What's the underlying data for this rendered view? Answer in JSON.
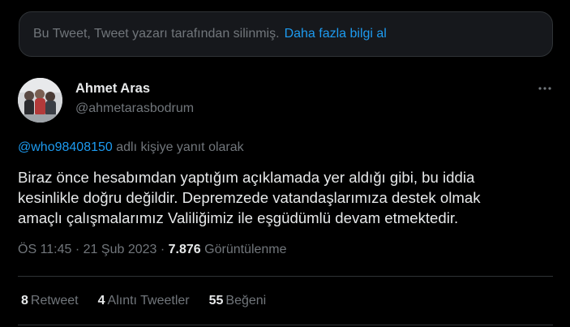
{
  "deleted_notice": {
    "text": "Bu Tweet, Tweet yazarı tarafından silinmiş.",
    "link": "Daha fazla bilgi al"
  },
  "author": {
    "name": "Ahmet Aras",
    "handle": "@ahmetarasbodrum"
  },
  "reply": {
    "mention": "@who98408150",
    "suffix": "adlı kişiye yanıt olarak"
  },
  "tweet": {
    "text": "Biraz önce hesabımdan yaptığım açıklamada yer aldığı gibi, bu iddia\nkesinlikle doğru değildir. Depremzede vatandaşlarımıza destek olmak\namaçlı çalışmalarımız Valiliğimiz ile eşgüdümlü devam etmektedir."
  },
  "meta": {
    "time": "ÖS 11:45",
    "date": "21 Şub 2023",
    "views": "7.876",
    "views_label": "Görüntülenme"
  },
  "stats": {
    "retweets": "8",
    "retweets_label": "Retweet",
    "quotes": "4",
    "quotes_label": "Alıntı Tweetler",
    "likes": "55",
    "likes_label": "Beğeni"
  },
  "colors": {
    "background": "#000000",
    "accent": "#1d9bf0",
    "secondary_text": "#71767b",
    "primary_text": "#e7e9ea"
  }
}
